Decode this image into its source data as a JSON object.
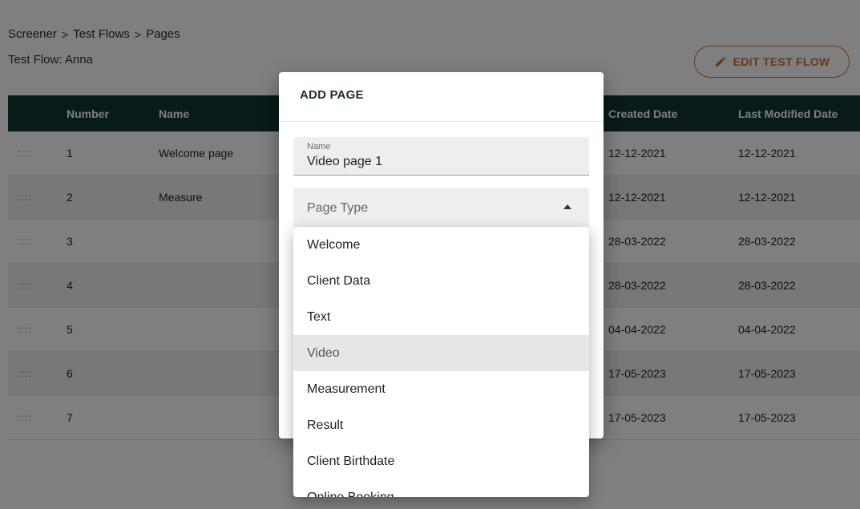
{
  "breadcrumb": [
    "Screener",
    "Test Flows",
    "Pages"
  ],
  "subtitle": "Test Flow: Anna",
  "edit_button": {
    "label": "EDIT TEST FLOW",
    "icon": "pencil-icon"
  },
  "colors": {
    "header_bg": "#123434",
    "accent": "#c9733a",
    "menu_hover": "#e6e6e6"
  },
  "table": {
    "columns": [
      "",
      "Number",
      "Name",
      "Created Date",
      "Last Modified Date"
    ],
    "rows": [
      {
        "drag": "::::",
        "number": "1",
        "name": "Welcome page",
        "created": "12-12-2021",
        "modified": "12-12-2021"
      },
      {
        "drag": "::::",
        "number": "2",
        "name": "Measure",
        "created": "12-12-2021",
        "modified": "12-12-2021"
      },
      {
        "drag": "::::",
        "number": "3",
        "name": "",
        "created": "28-03-2022",
        "modified": "28-03-2022"
      },
      {
        "drag": "::::",
        "number": "4",
        "name": "",
        "created": "28-03-2022",
        "modified": "28-03-2022"
      },
      {
        "drag": "::::",
        "number": "5",
        "name": "",
        "created": "04-04-2022",
        "modified": "04-04-2022"
      },
      {
        "drag": "::::",
        "number": "6",
        "name": "",
        "created": "17-05-2023",
        "modified": "17-05-2023"
      },
      {
        "drag": "::::",
        "number": "7",
        "name": "",
        "created": "17-05-2023",
        "modified": "17-05-2023"
      }
    ]
  },
  "dialog": {
    "title": "ADD PAGE",
    "name_field": {
      "label": "Name",
      "value": "Video page 1"
    },
    "page_type": {
      "label": "Page Type",
      "expanded": true
    },
    "options": [
      "Welcome",
      "Client Data",
      "Text",
      "Video",
      "Measurement",
      "Result",
      "Client Birthdate",
      "Online Booking"
    ],
    "hovered_option": "Video"
  }
}
